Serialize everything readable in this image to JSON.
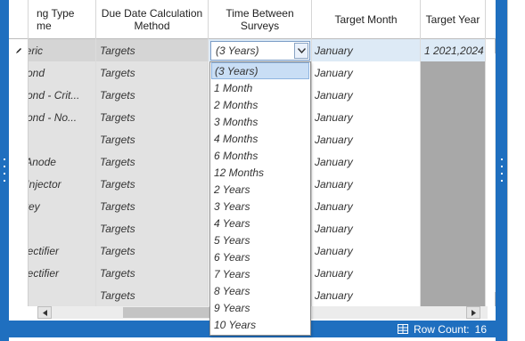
{
  "header": {
    "col1": [
      "ng Type",
      "me"
    ],
    "col2": [
      "Due Date Calculation",
      "Method"
    ],
    "col3": [
      "Time Between",
      "Surveys"
    ],
    "col4": "Target Month",
    "col5": "Target Year"
  },
  "rows": [
    {
      "c1": "neric",
      "c2": "Targets",
      "c3": "(3 Years)",
      "c4": "January",
      "c5": "1   2021,2024",
      "sel": true
    },
    {
      "c1": "Bond",
      "c2": "Targets",
      "c4": "January"
    },
    {
      "c1": "Bond - Crit...",
      "c2": "Targets",
      "c4": "January"
    },
    {
      "c1": "Bond - No...",
      "c2": "Targets",
      "c4": "January"
    },
    {
      "c1": "",
      "c2": "Targets",
      "c4": "January"
    },
    {
      "c1": "t Anode",
      "c2": "Targets",
      "c4": "January"
    },
    {
      "c1": "r Injector",
      "c2": "Targets",
      "c4": "January"
    },
    {
      "c1": "rvey",
      "c2": "Targets",
      "c4": "January"
    },
    {
      "c1": "te",
      "c2": "Targets",
      "c4": "January"
    },
    {
      "c1": "Rectifier",
      "c2": "Targets",
      "c4": "January"
    },
    {
      "c1": "Rectifier",
      "c2": "Targets",
      "c4": "January"
    },
    {
      "c1": "",
      "c2": "Targets",
      "c4": "January"
    }
  ],
  "combo": {
    "value": "(3 Years)"
  },
  "dropdown": {
    "options": [
      "(3 Years)",
      "1 Month",
      "2 Months",
      "3 Months",
      "4 Months",
      "6 Months",
      "12 Months",
      "2 Years",
      "3 Years",
      "4 Years",
      "5 Years",
      "6 Years",
      "7 Years",
      "8 Years",
      "9 Years",
      "10 Years"
    ],
    "selected_index": 0
  },
  "status": {
    "label": "Row Count:",
    "count": "16"
  },
  "icons": {
    "editing": "pencil-icon",
    "row_count": "table-icon",
    "combo": "chevron-down-icon"
  },
  "colors": {
    "accent": "#1f6fbf",
    "readonly_cell": "#e2e2e2",
    "selected_option": "#c9def5",
    "disabled_cell": "#a8a8a8"
  }
}
